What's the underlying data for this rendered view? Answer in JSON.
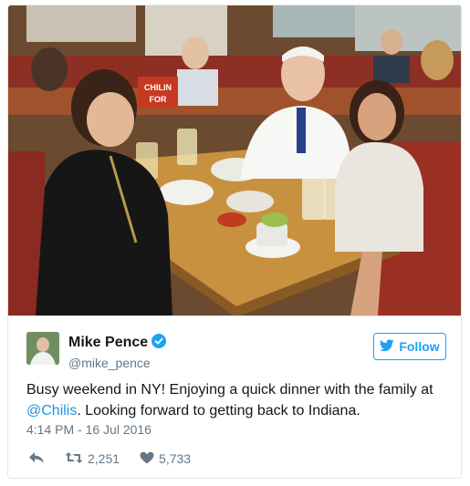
{
  "tweet": {
    "display_name": "Mike Pence",
    "verified_icon": "verified-badge-icon",
    "handle": "@mike_pence",
    "follow_label": "Follow",
    "text_before": "Busy weekend in NY! Enjoying a quick dinner with the family at ",
    "mention": "@Chilis",
    "text_after": ". Looking forward to getting back to Indiana.",
    "timestamp": "4:14 PM - 16 Jul 2016",
    "reply_icon": "reply-icon",
    "retweet_icon": "retweet-icon",
    "retweet_count": "2,251",
    "like_icon": "heart-icon",
    "like_count": "5,733"
  },
  "photo": {
    "sign_text_1": "CHILIN",
    "sign_text_2": "FOR"
  },
  "colors": {
    "accent": "#1da1f2",
    "verified": "#1da1f2",
    "mention": "#1b95e0",
    "muted": "#657786"
  }
}
